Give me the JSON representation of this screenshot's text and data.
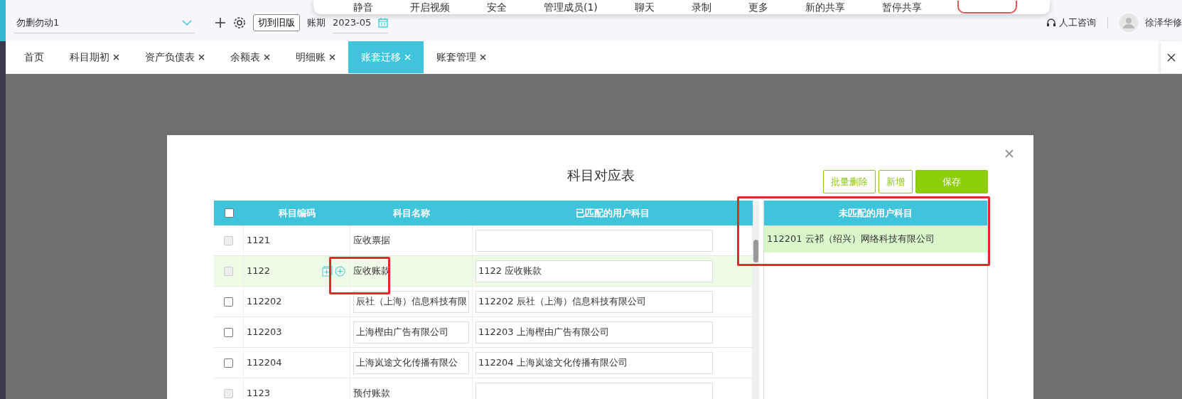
{
  "meeting_toolbar": {
    "items": [
      "静音",
      "开启视频",
      "安全",
      "管理成员(1)",
      "聊天",
      "录制",
      "更多",
      "新的共享",
      "暂停共享"
    ]
  },
  "header": {
    "book": "勿删勿动1",
    "old_version_button": "切到旧版",
    "period_label": "账期",
    "period": "2023-05",
    "support": "人工咨询",
    "user": "徐泽华修"
  },
  "tabs": [
    {
      "label": "首页",
      "closable": false,
      "selected": false
    },
    {
      "label": "科目期初",
      "closable": true,
      "selected": false
    },
    {
      "label": "资产负债表",
      "closable": true,
      "selected": false
    },
    {
      "label": "余额表",
      "closable": true,
      "selected": false
    },
    {
      "label": "明细账",
      "closable": true,
      "selected": false
    },
    {
      "label": "账套迁移",
      "closable": true,
      "selected": true
    },
    {
      "label": "账套管理",
      "closable": true,
      "selected": false
    }
  ],
  "modal": {
    "title": "科目对应表",
    "buttons": [
      {
        "label": "批量删除",
        "kind": "outline"
      },
      {
        "label": "新增",
        "kind": "outline"
      },
      {
        "label": "保存",
        "kind": "primary"
      }
    ],
    "table": {
      "columns": [
        "科目编码",
        "科目名称",
        "已匹配的用户科目"
      ],
      "select_all_checked": false,
      "rows": [
        {
          "code": "1121",
          "kind": "parent",
          "name": "应收票据",
          "disabled": true,
          "selected": false,
          "show_actions": false
        },
        {
          "code": "1122",
          "kind": "parent",
          "name": "应收账款",
          "matched": "1122 应收账款",
          "disabled": true,
          "selected": true,
          "show_actions": true
        },
        {
          "code": "112202",
          "kind": "child",
          "name": "辰社（上海）信息科技有限",
          "matched": "112202 辰社（上海）信息科技有限公司",
          "disabled": false,
          "selected": false,
          "show_actions": false
        },
        {
          "code": "112203",
          "kind": "child",
          "name": "上海樫由广告有限公司",
          "matched": "112203 上海樫由广告有限公司",
          "disabled": false,
          "selected": false,
          "show_actions": false
        },
        {
          "code": "112204",
          "kind": "child",
          "name": "上海岚途文化传播有限公",
          "matched": "112204 上海岚途文化传播有限公司",
          "disabled": false,
          "selected": false,
          "show_actions": false
        },
        {
          "code": "1123",
          "kind": "parent",
          "name": "预付账款",
          "disabled": true,
          "selected": false,
          "show_actions": false
        }
      ]
    },
    "unmatched": {
      "title": "未匹配的用户科目",
      "items": [
        {
          "label": "112201 云祁（绍兴）网络科技有限公司",
          "selected": true
        }
      ]
    }
  }
}
